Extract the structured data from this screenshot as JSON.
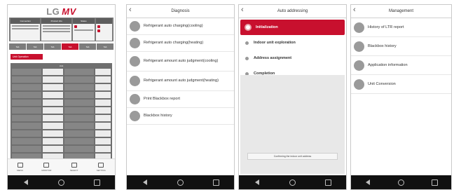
{
  "screen1": {
    "logo": {
      "lg": "LG",
      "mv": "MV"
    },
    "info_headers": [
      "Connection",
      "Product Info",
      "Status",
      ""
    ],
    "tabs": [
      "Tab",
      "Tab",
      "Tab",
      "Tab",
      "Tab",
      "Tab"
    ],
    "active_tab_index": 3,
    "action_button": "Unit Operation",
    "table_header": "Unit",
    "table_rows": 14,
    "bottom_nav": [
      "MENU",
      "MONITOR",
      "SELECT",
      "SETTING"
    ]
  },
  "screen2": {
    "title": "Diagnosis",
    "items": [
      "Refrigerant auto charging(cooling)",
      "Refrigerant auto charging(heating)",
      "Refrigerant amount auto judgment(cooling)",
      "Refrigerant amount auto judgment(heating)",
      "Print Blackbox report",
      "Blackbox history"
    ]
  },
  "screen3": {
    "title": "Auto addressing",
    "steps": [
      "Initialization",
      "Indoor unit exploration",
      "Address assignment",
      "Completion"
    ],
    "active_step_index": 0,
    "confirm_label": "Confirming the indoor unit address"
  },
  "screen4": {
    "title": "Management",
    "items": [
      "History of LTR report",
      "Blackbox history",
      "Application information",
      "Unit Conversion"
    ]
  },
  "colors": {
    "accent": "#c8102e",
    "panel_grey": "#7c7c7c",
    "navbar": "#111111"
  },
  "icons": {
    "back": "chevron-left-icon",
    "nav": [
      "back-triangle-icon",
      "home-circle-icon",
      "recent-square-icon"
    ]
  }
}
